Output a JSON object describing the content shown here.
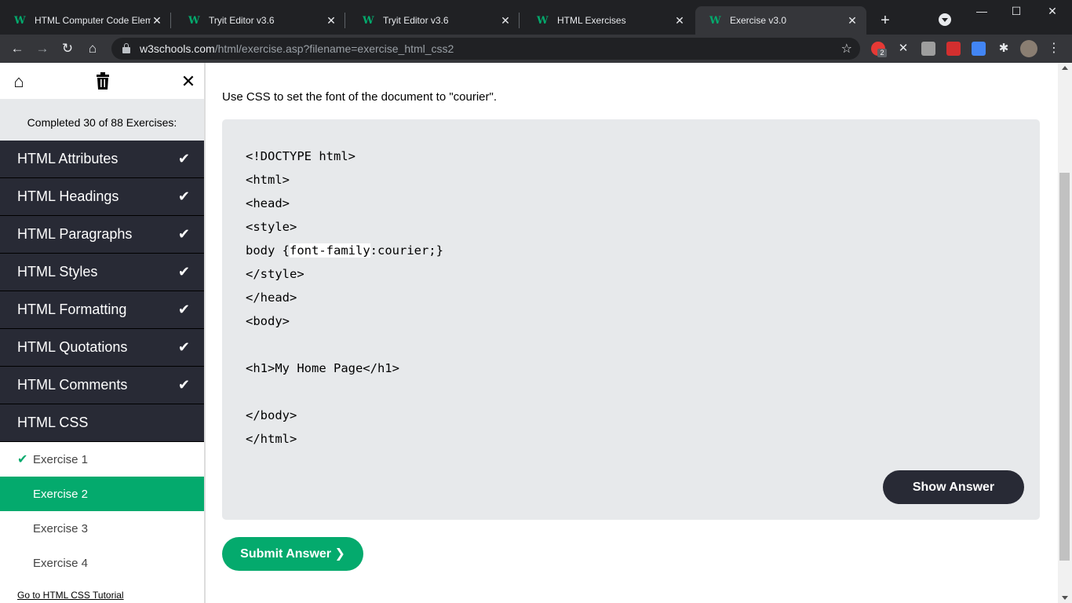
{
  "browser": {
    "tabs": [
      {
        "title": "HTML Computer Code Eleme",
        "active": false
      },
      {
        "title": "Tryit Editor v3.6",
        "active": false
      },
      {
        "title": "Tryit Editor v3.6",
        "active": false
      },
      {
        "title": "HTML Exercises",
        "active": false
      },
      {
        "title": "Exercise v3.0",
        "active": true
      }
    ],
    "favicon_letter": "W",
    "url_host": "w3schools.com",
    "url_path": "/html/exercise.asp?filename=exercise_html_css2",
    "extension_badge": "2"
  },
  "sidebar": {
    "completed_text": "Completed 30 of 88 Exercises:",
    "topics": [
      {
        "label": "HTML Attributes",
        "done": true
      },
      {
        "label": "HTML Headings",
        "done": true
      },
      {
        "label": "HTML Paragraphs",
        "done": true
      },
      {
        "label": "HTML Styles",
        "done": true
      },
      {
        "label": "HTML Formatting",
        "done": true
      },
      {
        "label": "HTML Quotations",
        "done": true
      },
      {
        "label": "HTML Comments",
        "done": true
      },
      {
        "label": "HTML CSS",
        "done": false
      }
    ],
    "exercises": [
      {
        "label": "Exercise 1",
        "done": true
      },
      {
        "label": "Exercise 2",
        "current": true
      },
      {
        "label": "Exercise 3"
      },
      {
        "label": "Exercise 4"
      }
    ],
    "tutorial_link": "Go to HTML CSS Tutorial"
  },
  "main": {
    "instruction": "Use CSS to set the font of the document to \"courier\".",
    "code": {
      "line1": "<!DOCTYPE html>",
      "line2": "<html>",
      "line3": "<head>",
      "line4": "<style>",
      "line5_pre": "body {",
      "line5_answer": "font-family",
      "line5_post": ":courier;}",
      "line6": "</style>",
      "line7": "</head>",
      "line8": "<body>",
      "line9": "",
      "line10": "<h1>My Home Page</h1>",
      "line11": "",
      "line12": "</body>",
      "line13": "</html>"
    },
    "show_answer_label": "Show Answer",
    "submit_label": "Submit Answer ❯"
  },
  "colors": {
    "accent_green": "#04aa6d",
    "dark_nav": "#282a35",
    "code_bg": "#e7e9eb"
  }
}
